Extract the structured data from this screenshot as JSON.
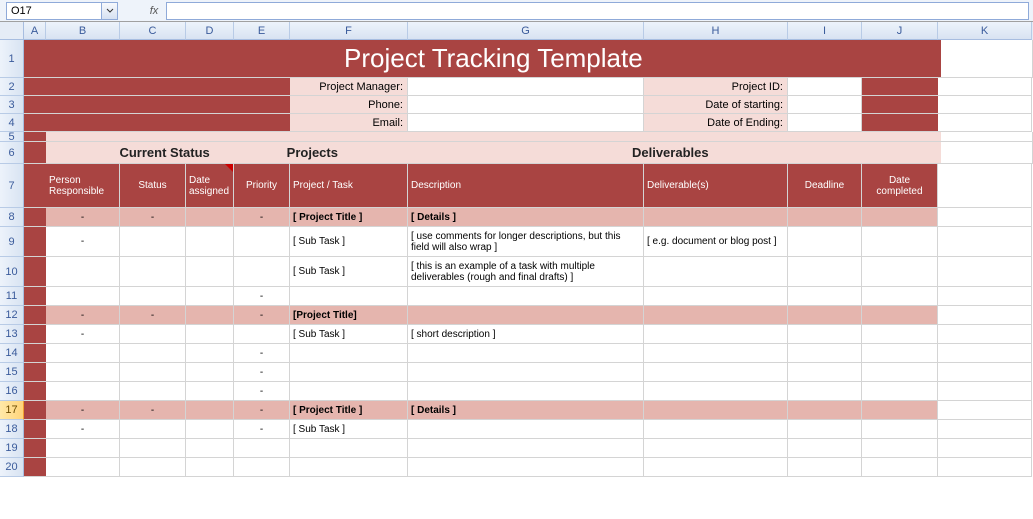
{
  "nameBox": "O17",
  "fx": "fx",
  "formula": "",
  "columns": [
    "A",
    "B",
    "C",
    "D",
    "E",
    "F",
    "G",
    "H",
    "I",
    "J",
    "K"
  ],
  "rowNums": [
    1,
    2,
    3,
    4,
    5,
    6,
    7,
    8,
    9,
    10,
    11,
    12,
    13,
    14,
    15,
    16,
    17,
    18,
    19,
    20
  ],
  "selectedRow": 17,
  "title": "Project Tracking Template",
  "fieldsLeft": {
    "pm": "Project Manager:",
    "phone": "Phone:",
    "email": "Email:"
  },
  "fieldsRight": {
    "pid": "Project ID:",
    "start": "Date of starting:",
    "end": "Date of Ending:"
  },
  "sections": {
    "status": "Current Status",
    "projects": "Projects",
    "deliverables": "Deliverables"
  },
  "headers": {
    "person": "Person Responsible",
    "status": "Status",
    "assigned": "Date assigned",
    "priority": "Priority",
    "task": "Project / Task",
    "desc": "Description",
    "deliv": "Deliverable(s)",
    "deadline": "Deadline",
    "done": "Date completed"
  },
  "rows": [
    {
      "type": "proj",
      "b": "-",
      "c": "-",
      "d": "",
      "e": "-",
      "f": "[ Project Title ]",
      "g": "[ Details ]",
      "h": "",
      "i": "",
      "j": ""
    },
    {
      "type": "sub",
      "b": "-",
      "c": "",
      "d": "",
      "e": "",
      "f": "[ Sub Task ]",
      "g": "[ use comments for longer descriptions, but this field will also wrap ]",
      "h": "[ e.g. document or blog post ]",
      "i": "",
      "j": ""
    },
    {
      "type": "sub",
      "b": "",
      "c": "",
      "d": "",
      "e": "",
      "f": "[ Sub Task ]",
      "g": "[ this is an example of a task with multiple deliverables (rough and final drafts) ]",
      "h": "",
      "i": "",
      "j": ""
    },
    {
      "type": "sub",
      "b": "",
      "c": "",
      "d": "",
      "e": "-",
      "f": "",
      "g": "",
      "h": "",
      "i": "",
      "j": ""
    },
    {
      "type": "proj",
      "b": "-",
      "c": "-",
      "d": "",
      "e": "-",
      "f": "[Project Title]",
      "g": "",
      "h": "",
      "i": "",
      "j": ""
    },
    {
      "type": "sub",
      "b": "-",
      "c": "",
      "d": "",
      "e": "",
      "f": "[ Sub Task ]",
      "g": "[ short description ]",
      "h": "",
      "i": "",
      "j": ""
    },
    {
      "type": "sub",
      "b": "",
      "c": "",
      "d": "",
      "e": "-",
      "f": "",
      "g": "",
      "h": "",
      "i": "",
      "j": ""
    },
    {
      "type": "sub",
      "b": "",
      "c": "",
      "d": "",
      "e": "-",
      "f": "",
      "g": "",
      "h": "",
      "i": "",
      "j": ""
    },
    {
      "type": "sub",
      "b": "",
      "c": "",
      "d": "",
      "e": "-",
      "f": "",
      "g": "",
      "h": "",
      "i": "",
      "j": ""
    },
    {
      "type": "proj",
      "b": "-",
      "c": "-",
      "d": "",
      "e": "-",
      "f": "[ Project Title ]",
      "g": "[ Details ]",
      "h": "",
      "i": "",
      "j": ""
    },
    {
      "type": "sub",
      "b": "-",
      "c": "",
      "d": "",
      "e": "-",
      "f": "[ Sub Task ]",
      "g": "",
      "h": "",
      "i": "",
      "j": ""
    },
    {
      "type": "sub",
      "b": "",
      "c": "",
      "d": "",
      "e": "",
      "f": "",
      "g": "",
      "h": "",
      "i": "",
      "j": ""
    },
    {
      "type": "sub",
      "b": "",
      "c": "",
      "d": "",
      "e": "",
      "f": "",
      "g": "",
      "h": "",
      "i": "",
      "j": ""
    }
  ],
  "chart_data": {
    "type": "table",
    "title": "Project Tracking Template",
    "columns": [
      "Person Responsible",
      "Status",
      "Date assigned",
      "Priority",
      "Project / Task",
      "Description",
      "Deliverable(s)",
      "Deadline",
      "Date completed"
    ],
    "rows": [
      [
        "-",
        "-",
        "",
        "-",
        "[ Project Title ]",
        "[ Details ]",
        "",
        "",
        ""
      ],
      [
        "-",
        "",
        "",
        "",
        "[ Sub Task ]",
        "[ use comments for longer descriptions, but this field will also wrap ]",
        "[ e.g. document or blog post ]",
        "",
        ""
      ],
      [
        "",
        "",
        "",
        "",
        "[ Sub Task ]",
        "[ this is an example of a task with multiple deliverables (rough and final drafts) ]",
        "",
        "",
        ""
      ],
      [
        "",
        "",
        "",
        "-",
        "",
        "",
        "",
        "",
        ""
      ],
      [
        "-",
        "-",
        "",
        "-",
        "[Project Title]",
        "",
        "",
        "",
        ""
      ],
      [
        "-",
        "",
        "",
        "",
        "[ Sub Task ]",
        "[ short description ]",
        "",
        "",
        ""
      ],
      [
        "",
        "",
        "",
        "-",
        "",
        "",
        "",
        "",
        ""
      ],
      [
        "",
        "",
        "",
        "-",
        "",
        "",
        "",
        "",
        ""
      ],
      [
        "",
        "",
        "",
        "-",
        "",
        "",
        "",
        "",
        ""
      ],
      [
        "-",
        "-",
        "",
        "-",
        "[ Project Title ]",
        "[ Details ]",
        "",
        "",
        ""
      ],
      [
        "-",
        "",
        "",
        "-",
        "[ Sub Task ]",
        "",
        "",
        "",
        ""
      ],
      [
        "",
        "",
        "",
        "",
        "",
        "",
        "",
        "",
        ""
      ],
      [
        "",
        "",
        "",
        "",
        "",
        "",
        "",
        "",
        ""
      ]
    ]
  }
}
